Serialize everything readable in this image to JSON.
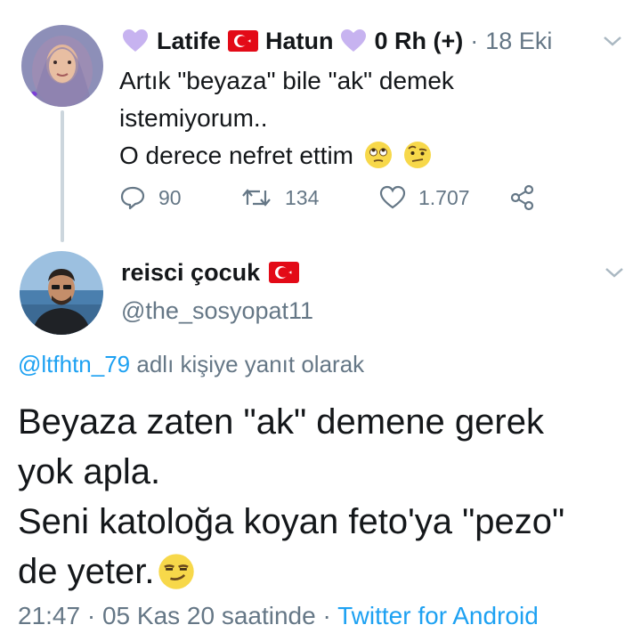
{
  "tweet1": {
    "name_part1": "Latife",
    "name_part2": "Hatun",
    "name_part3": "0 Rh (+)",
    "separator": "·",
    "date": "18 Eki",
    "lines": [
      "Artık \"beyaza\" bile \"ak\" demek",
      "istemiyorum..",
      "O derece nefret ettim"
    ],
    "reply_count": "90",
    "retweet_count": "134",
    "like_count": "1.707",
    "icons": [
      "purple-heart-icon",
      "turkey-flag-icon",
      "eye-roll-emoji-icon",
      "raised-eyebrow-emoji-icon",
      "reply-icon",
      "retweet-icon",
      "like-icon",
      "share-icon",
      "chevron-down-icon"
    ]
  },
  "tweet2": {
    "name": "reisci çocuk",
    "handle": "@the_sosyopat11",
    "reply_to_mention": "@ltfhtn_79",
    "reply_to_suffix": "adlı kişiye yanıt olarak",
    "lines": [
      "Beyaza zaten \"ak\" demene gerek",
      "yok apla.",
      "Seni katoloğa koyan feto'ya \"pezo\"",
      "de yeter."
    ],
    "time": "21:47",
    "sep": "·",
    "date": "05 Kas 20 saatinde",
    "sep2": "·",
    "app": "Twitter for Android",
    "icons": [
      "turkey-flag-icon",
      "smirk-emoji-icon",
      "chevron-down-icon"
    ]
  },
  "colors": {
    "text": "#14171a",
    "secondary": "#657786",
    "link": "#1da1f2",
    "heart": "#c7b3f0",
    "flag_red": "#e30a17",
    "thread_line": "#ccd6dd"
  }
}
